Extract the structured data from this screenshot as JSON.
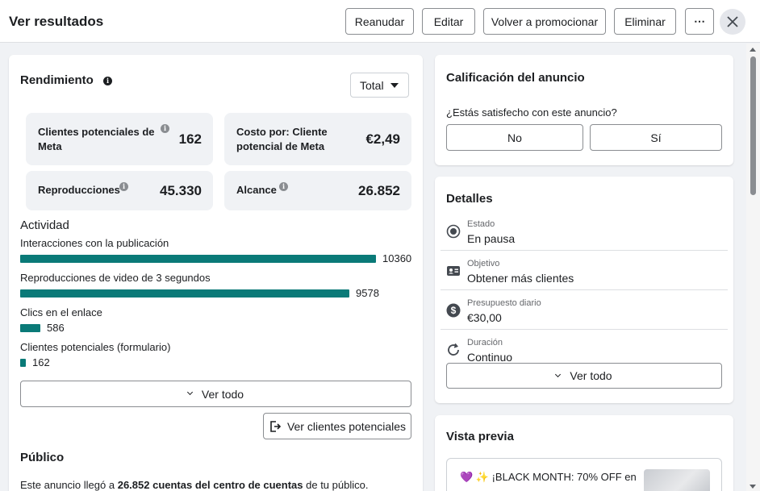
{
  "header": {
    "title": "Ver resultados",
    "buttons": {
      "resume": "Reanudar",
      "edit": "Editar",
      "promote_again": "Volver a promocionar",
      "delete": "Eliminar",
      "more": "⋯"
    },
    "close_glyph": "✕"
  },
  "performance": {
    "title": "Rendimiento",
    "dropdown_value": "Total",
    "metrics": [
      {
        "label": "Clientes potenciales de Meta",
        "value": "162"
      },
      {
        "label": "Costo por: Cliente potencial de Meta",
        "value": "€2,49"
      },
      {
        "label": "Reproducciones",
        "value": "45.330"
      },
      {
        "label": "Alcance",
        "value": "26.852"
      }
    ]
  },
  "activity": {
    "title": "Actividad",
    "items": [
      {
        "label": "Interacciones con la publicación",
        "value": 10360
      },
      {
        "label": "Reproducciones de video de 3 segundos",
        "value": 9578
      },
      {
        "label": "Clics en el enlace",
        "value": 586
      },
      {
        "label": "Clientes potenciales (formulario)",
        "value": 162
      }
    ],
    "see_all": "Ver todo",
    "see_leads": "Ver clientes potenciales",
    "bar_color": "#0a7a78"
  },
  "audience": {
    "title": "Público",
    "sentence_prefix": "Este anuncio llegó a",
    "sentence_bold": "26.852 cuentas del centro de cuentas",
    "sentence_suffix": "de tu público."
  },
  "rating": {
    "title": "Calificación del anuncio",
    "question": "¿Estás satisfecho con este anuncio?",
    "no": "No",
    "yes": "Sí"
  },
  "details": {
    "title": "Detalles",
    "rows": [
      {
        "label": "Estado",
        "value": "En pausa",
        "icon": "radio-icon"
      },
      {
        "label": "Objetivo",
        "value": "Obtener más clientes",
        "icon": "id-card-icon"
      },
      {
        "label": "Presupuesto diario",
        "value": "€30,00",
        "icon": "dollar-icon"
      },
      {
        "label": "Duración",
        "value": "Continuo",
        "icon": "refresh-icon"
      }
    ],
    "see_all": "Ver todo"
  },
  "preview": {
    "title": "Vista previa",
    "text": "💜 ✨ ¡BLACK MONTH: 70% OFF en"
  }
}
